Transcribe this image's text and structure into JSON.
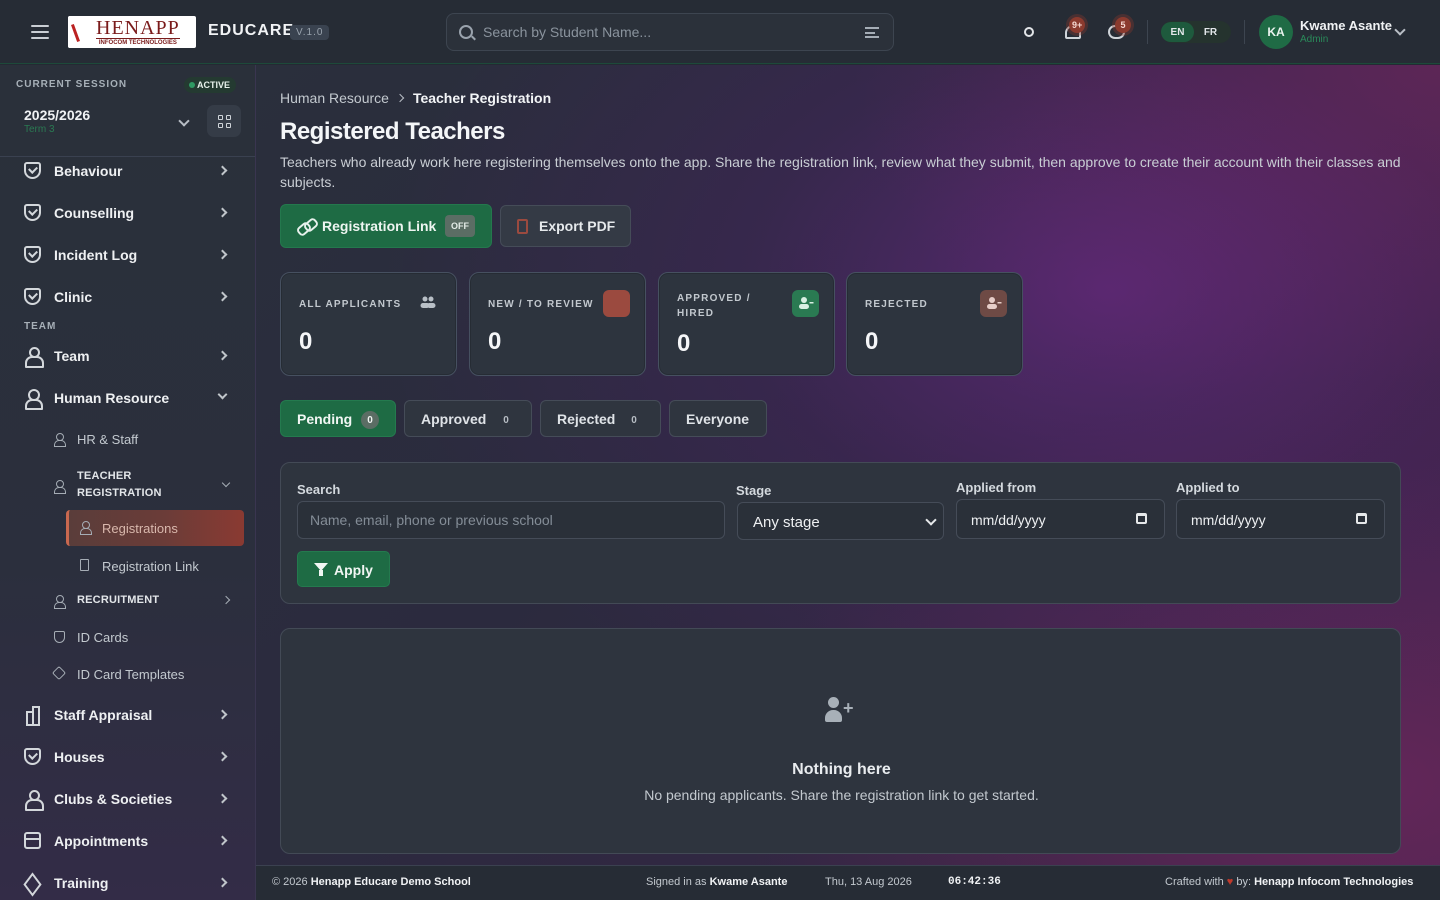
{
  "header": {
    "logo_text": "HENAPP",
    "logo_subtext": "INFOCOM TECHNOLOGIES",
    "brand": "EDUCARE",
    "version": "V.1.0",
    "search_placeholder": "Search by Student Name...",
    "notifications_badge": "9+",
    "messages_badge": "5",
    "lang_en": "EN",
    "lang_fr": "FR",
    "user_initials": "KA",
    "user_name": "Kwame Asante",
    "user_role": "Admin"
  },
  "session": {
    "label": "CURRENT SESSION",
    "status": "ACTIVE",
    "year": "2025/2026",
    "term": "Term 3"
  },
  "sidebar": {
    "items_top": [
      {
        "label": "Behaviour",
        "icon": "shield-check-icon"
      },
      {
        "label": "Counselling",
        "icon": "shield-check-icon"
      },
      {
        "label": "Incident Log",
        "icon": "shield-check-icon"
      },
      {
        "label": "Clinic",
        "icon": "shield-check-icon"
      }
    ],
    "section_team": "TEAM",
    "team": "Team",
    "human_resource": "Human Resource",
    "hr_staff": "HR & Staff",
    "teacher_registration": "TEACHER REGISTRATION",
    "registrations": "Registrations",
    "registration_link": "Registration Link",
    "recruitment": "RECRUITMENT",
    "id_cards": "ID Cards",
    "id_card_templates": "ID Card Templates",
    "staff_appraisal": "Staff Appraisal",
    "houses": "Houses",
    "clubs": "Clubs & Societies",
    "appointments": "Appointments",
    "training": "Training"
  },
  "breadcrumb": {
    "parent": "Human Resource",
    "current": "Teacher Registration"
  },
  "page": {
    "title": "Registered Teachers",
    "description": "Teachers who already work here registering themselves onto the app. Share the registration link, review what they submit, then approve to create their account with their classes and subjects."
  },
  "actions": {
    "registration_link": "Registration Link",
    "link_status": "OFF",
    "export_pdf": "Export PDF"
  },
  "stats": [
    {
      "label": "ALL APPLICANTS",
      "value": "0",
      "icon": "users-icon",
      "color": ""
    },
    {
      "label": "NEW / TO REVIEW",
      "value": "0",
      "icon": "inbox-icon",
      "color": "#9b4a3f"
    },
    {
      "label": "APPROVED / HIRED",
      "value": "0",
      "icon": "user-check-icon",
      "color": "#2a7a52"
    },
    {
      "label": "REJECTED",
      "value": "0",
      "icon": "user-x-icon",
      "color": "#6e4a45"
    }
  ],
  "tabs": [
    {
      "label": "Pending",
      "count": "0"
    },
    {
      "label": "Approved",
      "count": "0"
    },
    {
      "label": "Rejected",
      "count": "0"
    },
    {
      "label": "Everyone",
      "count": ""
    }
  ],
  "filters": {
    "search_label": "Search",
    "search_placeholder": "Name, email, phone or previous school",
    "stage_label": "Stage",
    "stage_value": "Any stage",
    "from_label": "Applied from",
    "from_value": "mm/dd/yyyy",
    "to_label": "Applied to",
    "to_value": "mm/dd/yyyy",
    "apply": "Apply"
  },
  "empty": {
    "title": "Nothing here",
    "subtitle": "No pending applicants. Share the registration link to get started."
  },
  "footer": {
    "copyright_prefix": "© 2026",
    "school": "Henapp Educare Demo School",
    "signed_prefix": "Signed in as",
    "signed_user": "Kwame Asante",
    "date": "Thu, 13 Aug 2026",
    "time": "06:42:36",
    "crafted_prefix": "Crafted with",
    "crafted_by": "by:",
    "company": "Henapp Infocom Technologies"
  }
}
